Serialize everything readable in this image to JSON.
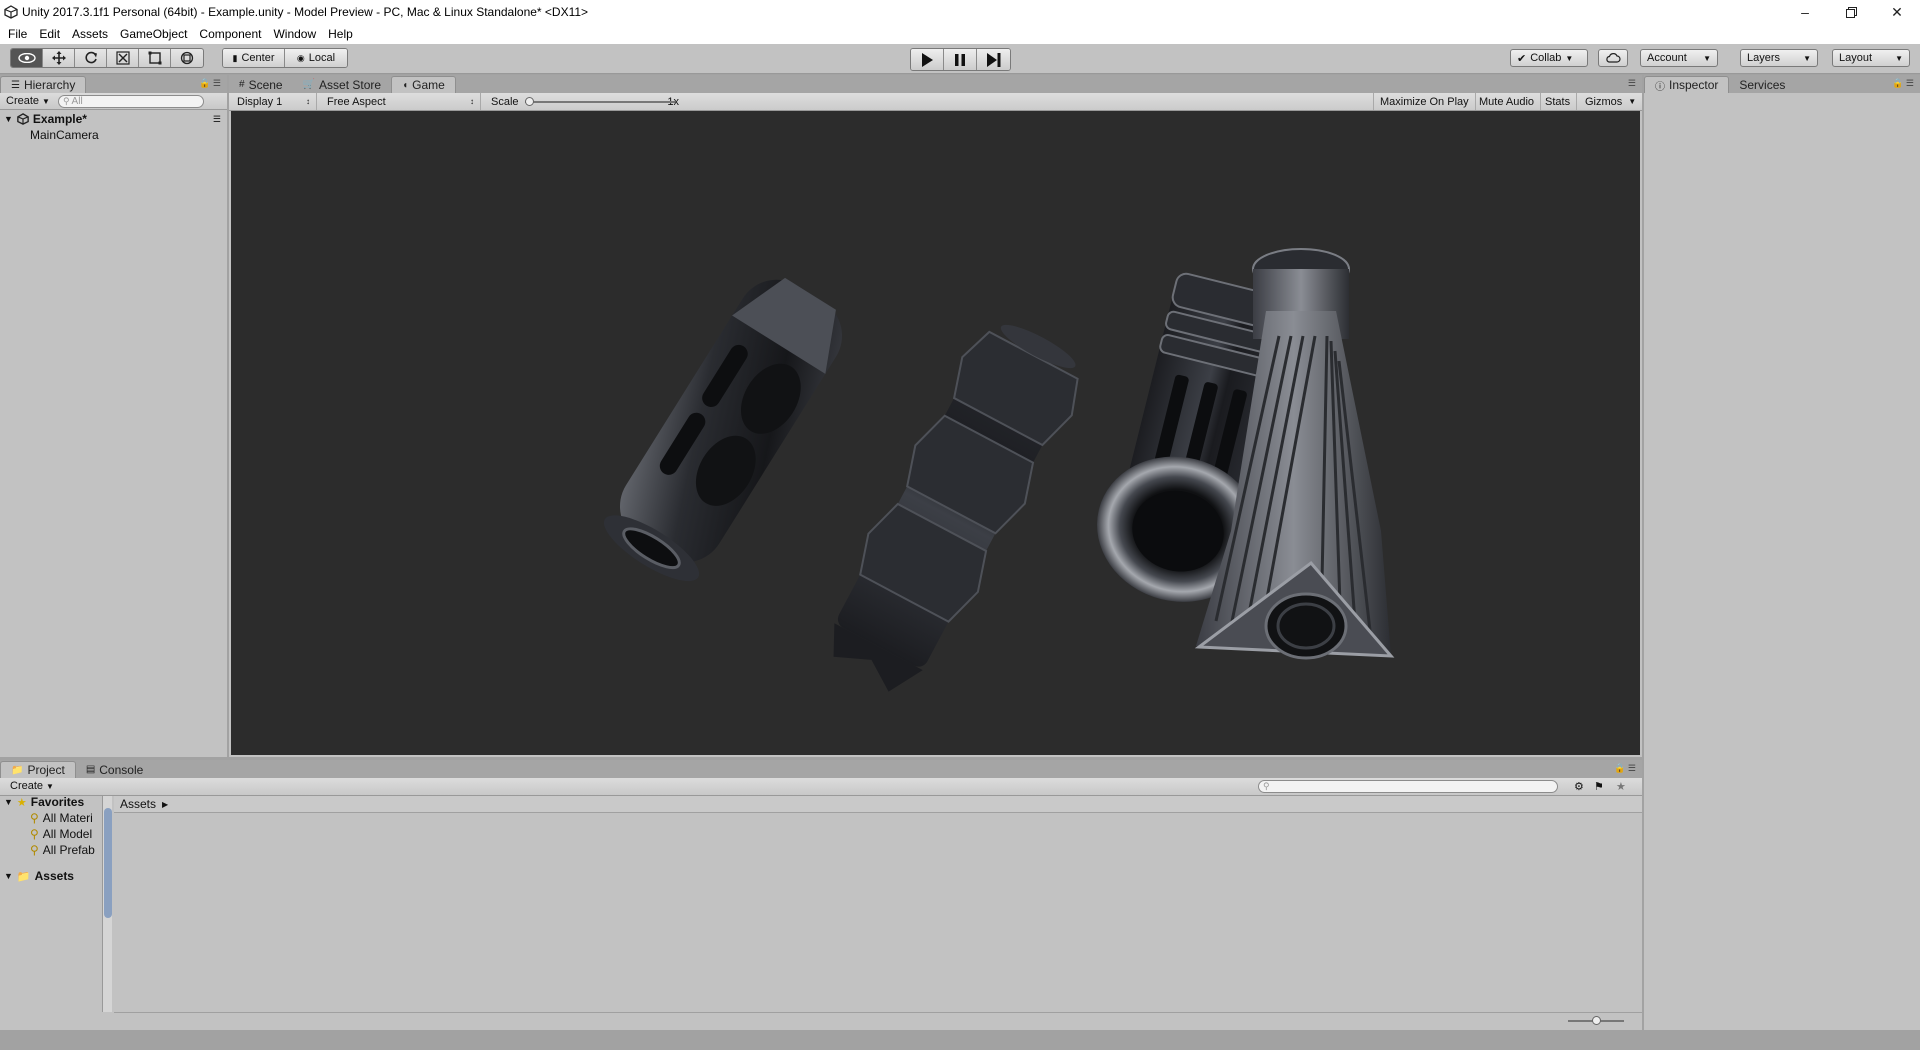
{
  "window": {
    "title": "Unity 2017.3.1f1 Personal (64bit) - Example.unity - Model Preview - PC, Mac & Linux Standalone* <DX11>"
  },
  "menu": [
    "File",
    "Edit",
    "Assets",
    "GameObject",
    "Component",
    "Window",
    "Help"
  ],
  "toolbar": {
    "pivot": "Center",
    "space": "Local",
    "collab": "Collab",
    "account": "Account",
    "layers": "Layers",
    "layout": "Layout"
  },
  "hierarchy": {
    "tab": "Hierarchy",
    "create": "Create",
    "search_placeholder": "All",
    "scene": "Example*",
    "objects": [
      "MainCamera"
    ]
  },
  "center_tabs": [
    "Scene",
    "Asset Store",
    "Game"
  ],
  "game": {
    "display": "Display 1",
    "aspect": "Free Aspect",
    "scale_label": "Scale",
    "scale_value": "1x",
    "maximize": "Maximize On Play",
    "mute": "Mute Audio",
    "stats": "Stats",
    "gizmos": "Gizmos"
  },
  "right_tabs": [
    "Inspector",
    "Services"
  ],
  "bottom_tabs": [
    "Project",
    "Console"
  ],
  "project": {
    "create": "Create",
    "favorites_label": "Favorites",
    "favorites": [
      "All Materi",
      "All Model",
      "All Prefab"
    ],
    "assets_label": "Assets",
    "breadcrumb": "Assets"
  },
  "colors": {
    "panel": "#c2c2c2",
    "viewport": "#2c2c2c",
    "tabstrip": "#a5a5a5"
  }
}
